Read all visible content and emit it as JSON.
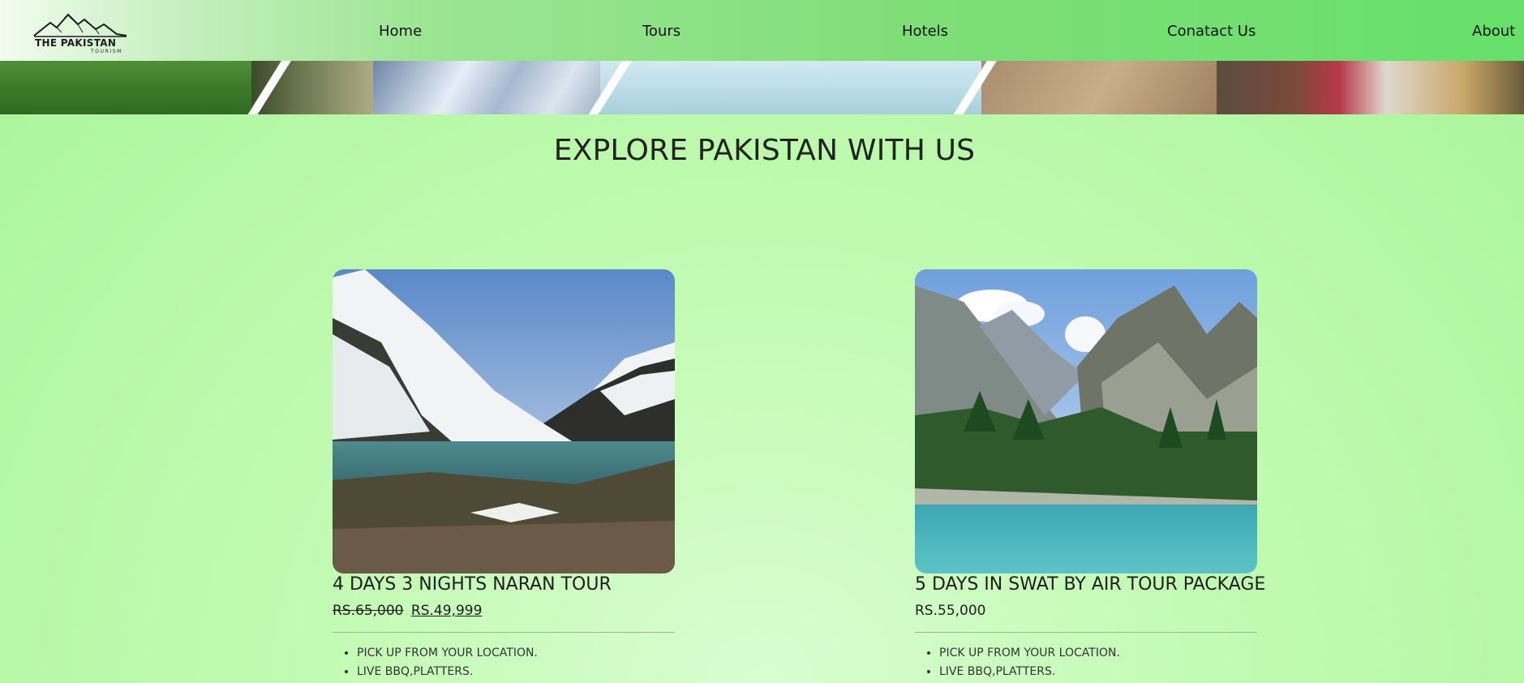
{
  "brand": {
    "title": "THE PAKISTAN",
    "subtitle": "TOURISM"
  },
  "nav": {
    "items": [
      {
        "label": "Home"
      },
      {
        "label": "Tours"
      },
      {
        "label": "Hotels"
      },
      {
        "label": "Conatact Us"
      },
      {
        "label": "About"
      }
    ]
  },
  "main": {
    "heading": "EXPLORE PAKISTAN WITH US"
  },
  "tours": [
    {
      "title": "4 DAYS 3 NIGHTS NARAN TOUR",
      "old_price": "RS.65,000",
      "price": "RS.49,999",
      "features": [
        "PICK UP FROM YOUR LOCATION.",
        "LIVE BBQ,PLATTERS."
      ]
    },
    {
      "title": "5 DAYS IN SWAT BY AIR TOUR PACKAGE",
      "price": "RS.55,000",
      "features": [
        "PICK UP FROM YOUR LOCATION.",
        "LIVE BBQ,PLATTERS."
      ]
    }
  ],
  "colors": {
    "nav_start": "#f2fcef",
    "nav_end": "#66e06a",
    "page_background": "#c3fbb4",
    "text": "#222222"
  }
}
